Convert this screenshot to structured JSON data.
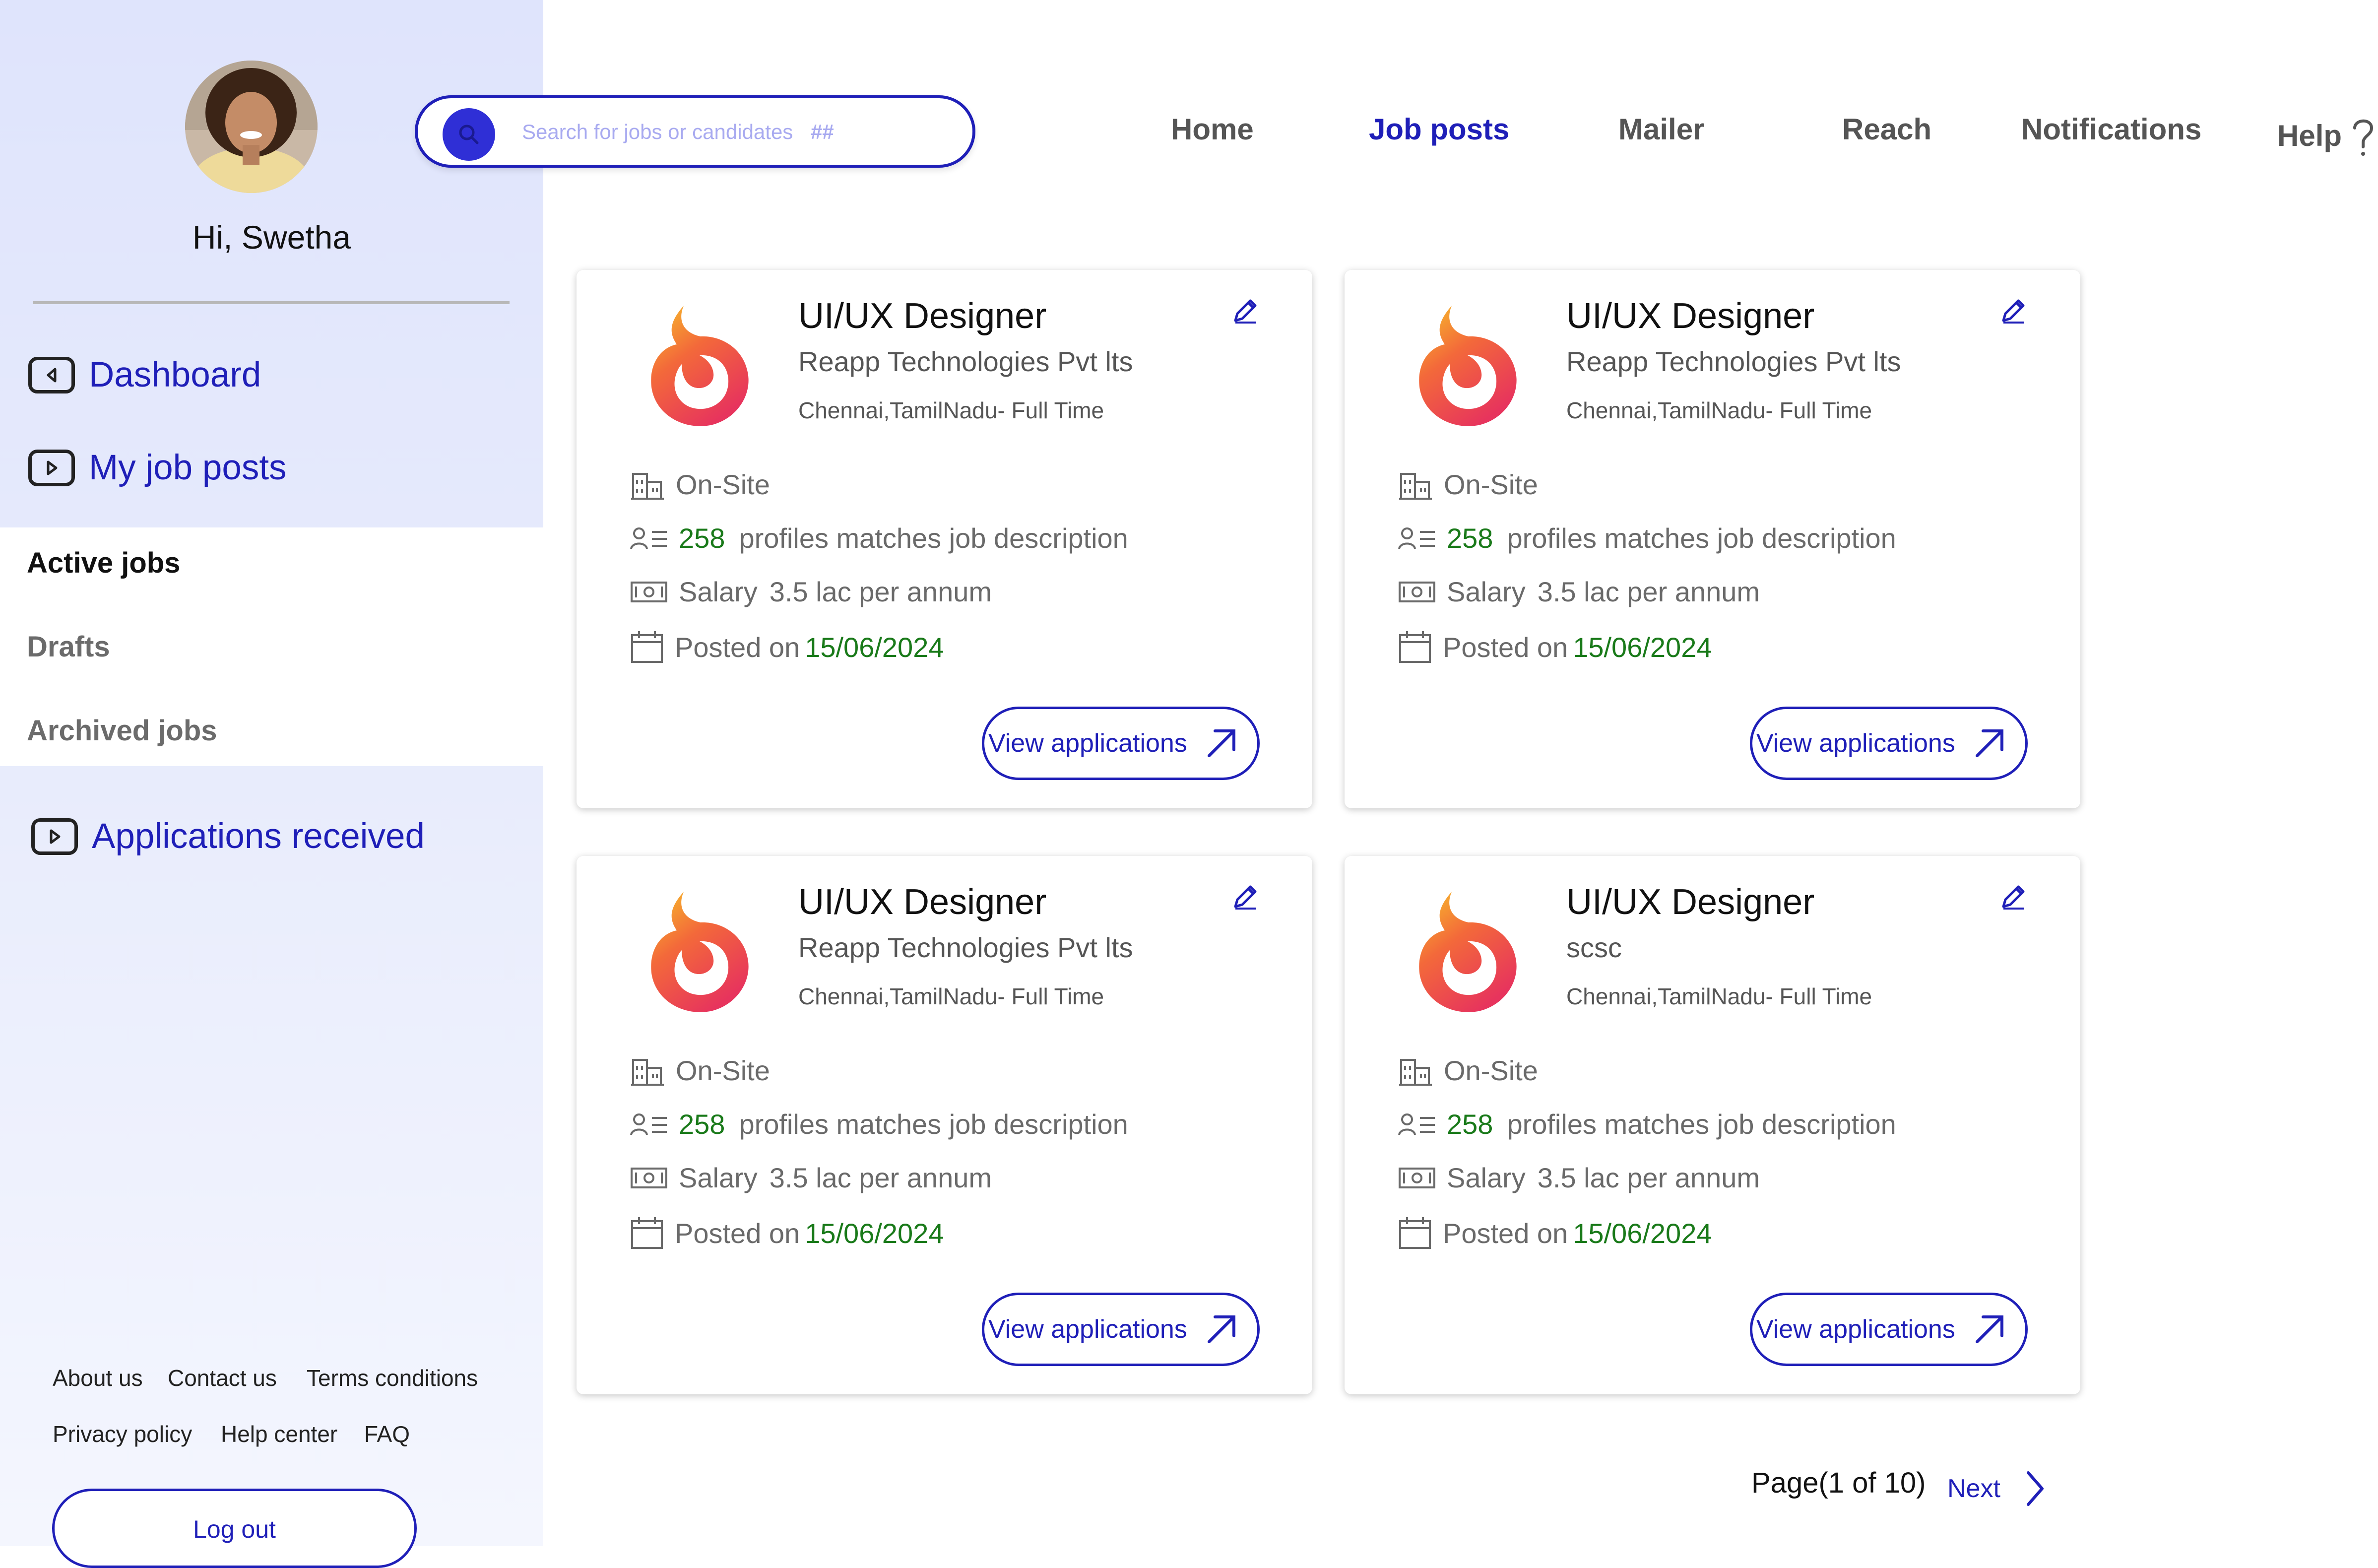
{
  "user": {
    "greeting": "Hi, Swetha"
  },
  "sidebar": {
    "nav": [
      {
        "label": "Dashboard"
      },
      {
        "label": "My job posts"
      }
    ],
    "sub_items": [
      {
        "label": "Active jobs",
        "active": true
      },
      {
        "label": "Drafts",
        "active": false
      },
      {
        "label": "Archived jobs",
        "active": false
      }
    ],
    "applications_label": "Applications received",
    "footer_links": [
      "About us",
      "Contact us",
      "Terms conditions",
      "Privacy policy",
      "Help center",
      "FAQ"
    ],
    "logout_label": "Log out"
  },
  "search": {
    "placeholder": "Search for jobs or candidates",
    "suffix": "##"
  },
  "top_nav": [
    {
      "label": "Home",
      "active": false
    },
    {
      "label": "Job posts",
      "active": true
    },
    {
      "label": "Mailer",
      "active": false
    },
    {
      "label": "Reach",
      "active": false
    },
    {
      "label": "Notifications",
      "active": false
    },
    {
      "label": "Help",
      "active": false
    }
  ],
  "cards": [
    {
      "title": "UI/UX Designer",
      "company": "Reapp Technologies Pvt lts",
      "location": "Chennai,TamilNadu- Full Time",
      "work_mode": "On-Site",
      "profiles_count": "258",
      "profiles_text": "profiles matches job description",
      "salary_label": "Salary",
      "salary_value": "3.5 lac per annum",
      "posted_label": "Posted on",
      "posted_date": "15/06/2024",
      "action_label": "View applications"
    },
    {
      "title": "UI/UX Designer",
      "company": "Reapp Technologies Pvt lts",
      "location": "Chennai,TamilNadu- Full Time",
      "work_mode": "On-Site",
      "profiles_count": "258",
      "profiles_text": "profiles matches job description",
      "salary_label": "Salary",
      "salary_value": "3.5 lac per annum",
      "posted_label": "Posted on",
      "posted_date": "15/06/2024",
      "action_label": "View applications"
    },
    {
      "title": "UI/UX Designer",
      "company": "Reapp Technologies Pvt lts",
      "location": "Chennai,TamilNadu- Full Time",
      "work_mode": "On-Site",
      "profiles_count": "258",
      "profiles_text": "profiles matches job description",
      "salary_label": "Salary",
      "salary_value": "3.5 lac per annum",
      "posted_label": "Posted on",
      "posted_date": "15/06/2024",
      "action_label": "View applications"
    },
    {
      "title": "UI/UX Designer",
      "company": "scsc",
      "location": "Chennai,TamilNadu- Full Time",
      "work_mode": "On-Site",
      "profiles_count": "258",
      "profiles_text": "profiles matches job description",
      "salary_label": "Salary",
      "salary_value": "3.5 lac per annum",
      "posted_label": "Posted on",
      "posted_date": "15/06/2024",
      "action_label": "View applications"
    }
  ],
  "pagination": {
    "info": "Page(1 of 10)",
    "next_label": "Next"
  },
  "colors": {
    "accent": "#1f1fb8",
    "green": "#1a7a1a",
    "sidebar_bg": "#dfe4fc"
  },
  "icons": [
    "search-icon",
    "back-icon",
    "play-icon",
    "pencil-icon",
    "building-icon",
    "profiles-icon",
    "cash-icon",
    "calendar-icon",
    "arrow-up-right-icon",
    "chevron-right-icon",
    "help-icon"
  ]
}
